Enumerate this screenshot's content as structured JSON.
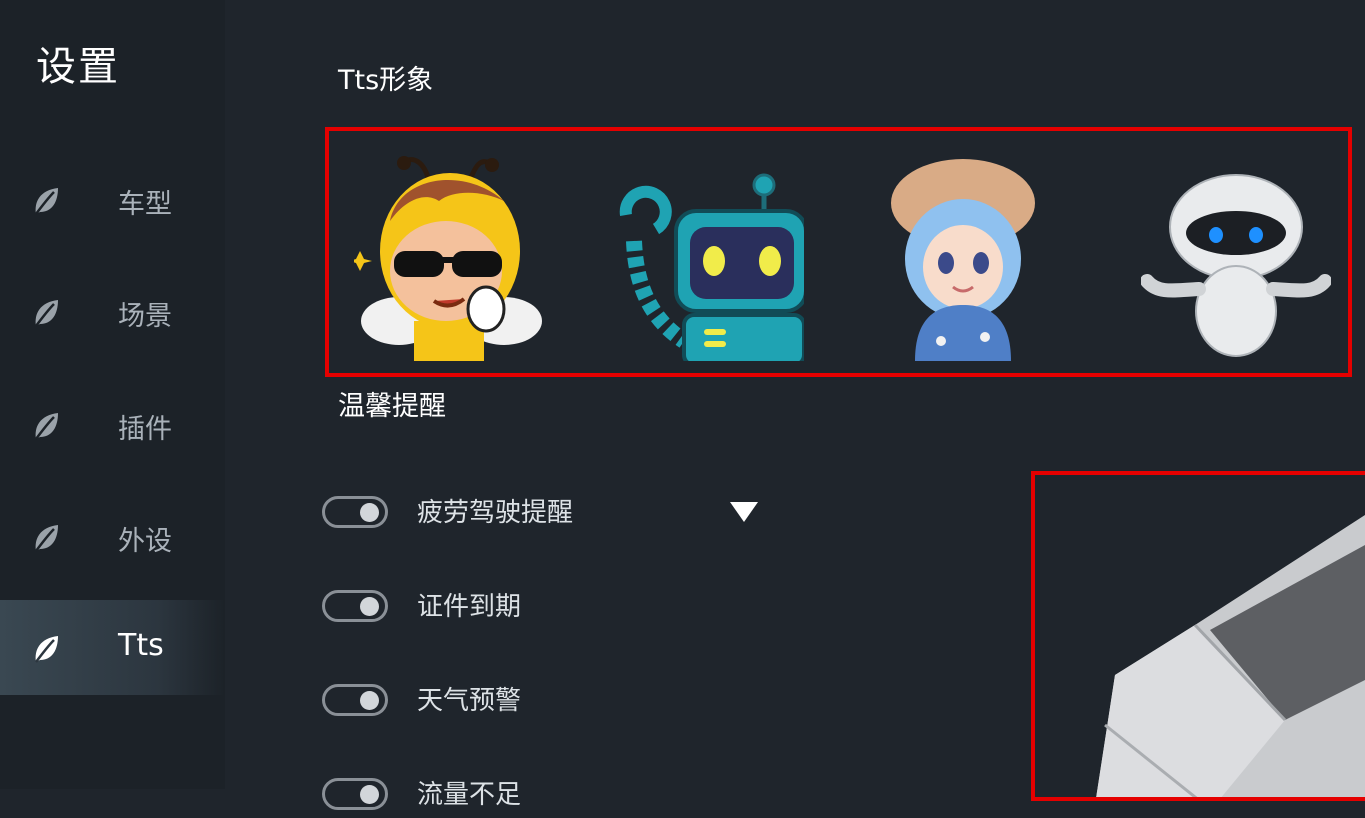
{
  "sidebar": {
    "title": "设置",
    "items": [
      {
        "label": "车型",
        "icon": "leaf-icon"
      },
      {
        "label": "场景",
        "icon": "leaf-icon"
      },
      {
        "label": "插件",
        "icon": "leaf-icon"
      },
      {
        "label": "外设",
        "icon": "leaf-icon"
      },
      {
        "label": "Tts",
        "icon": "leaf-icon",
        "active": true
      }
    ]
  },
  "tts_avatar": {
    "title": "Tts形象",
    "avatars": [
      {
        "name": "bee-sunglasses-avatar"
      },
      {
        "name": "teal-robot-avatar"
      },
      {
        "name": "blue-hair-girl-avatar"
      },
      {
        "name": "white-robot-avatar"
      }
    ]
  },
  "reminders": {
    "title": "温馨提醒",
    "items": [
      {
        "label": "疲劳驾驶提醒",
        "on": true
      },
      {
        "label": "证件到期",
        "on": true
      },
      {
        "label": "天气预警",
        "on": true
      },
      {
        "label": "流量不足",
        "on": true
      }
    ]
  },
  "colors": {
    "background": "#1f252c",
    "sidebar": "#1c2228",
    "highlight_border": "#e50000",
    "active_nav": "#3a4852"
  }
}
